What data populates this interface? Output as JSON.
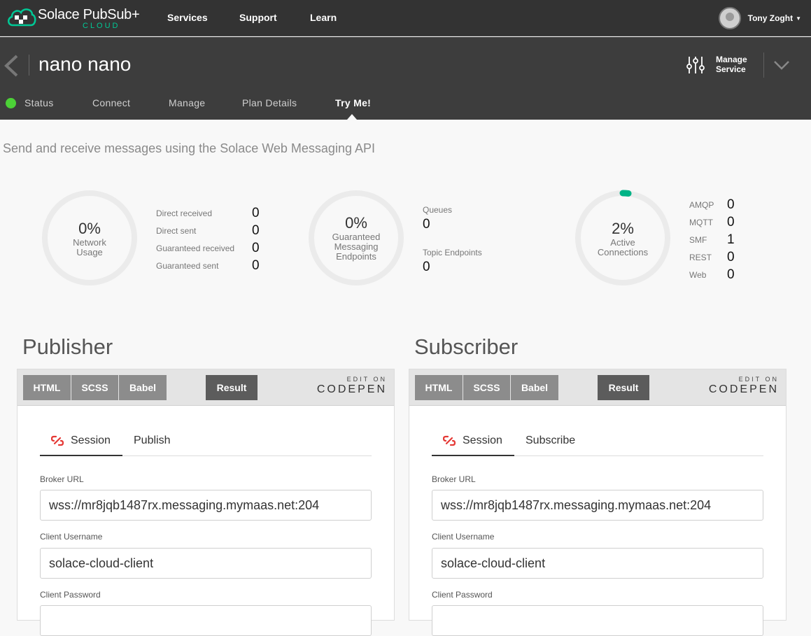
{
  "brand": {
    "name": "Solace PubSub+",
    "sub": "CLOUD",
    "accent": "#00c895"
  },
  "nav": {
    "links": [
      "Services",
      "Support",
      "Learn"
    ],
    "user_name": "Tony Zoght"
  },
  "service": {
    "title": "nano nano",
    "manage_label_1": "Manage",
    "manage_label_2": "Service",
    "tabs": [
      "Status",
      "Connect",
      "Manage",
      "Plan Details",
      "Try Me!"
    ],
    "active_tab": "Try Me!",
    "status_color": "#4cd137"
  },
  "subtitle": "Send and receive messages using the Solace Web Messaging API",
  "stats": {
    "network": {
      "pct": "0%",
      "label_1": "Network",
      "label_2": "Usage",
      "rows": [
        {
          "label": "Direct received",
          "value": "0"
        },
        {
          "label": "Direct sent",
          "value": "0"
        },
        {
          "label": "Guaranteed received",
          "value": "0"
        },
        {
          "label": "Guaranteed sent",
          "value": "0"
        }
      ]
    },
    "endpoints": {
      "pct": "0%",
      "label_1": "Guaranteed",
      "label_2": "Messaging",
      "label_3": "Endpoints",
      "rows": [
        {
          "label": "Queues",
          "value": "0"
        },
        {
          "label": "Topic Endpoints",
          "value": "0"
        }
      ]
    },
    "connections": {
      "pct": "2%",
      "fill": 0.02,
      "label_1": "Active",
      "label_2": "Connections",
      "rows": [
        {
          "label": "AMQP",
          "value": "0"
        },
        {
          "label": "MQTT",
          "value": "0"
        },
        {
          "label": "SMF",
          "value": "1"
        },
        {
          "label": "REST",
          "value": "0"
        },
        {
          "label": "Web",
          "value": "0"
        }
      ]
    }
  },
  "codepen": {
    "buttons": [
      "HTML",
      "SCSS",
      "Babel"
    ],
    "result": "Result",
    "edit_on": "EDIT ON",
    "brand": "CODEPEN"
  },
  "publisher": {
    "title": "Publisher",
    "tabs": [
      "Session",
      "Publish"
    ],
    "broker_label": "Broker URL",
    "broker_value": "wss://mr8jqb1487rx.messaging.mymaas.net:204",
    "username_label": "Client Username",
    "username_value": "solace-cloud-client",
    "password_label": "Client Password"
  },
  "subscriber": {
    "title": "Subscriber",
    "tabs": [
      "Session",
      "Subscribe"
    ],
    "broker_label": "Broker URL",
    "broker_value": "wss://mr8jqb1487rx.messaging.mymaas.net:204",
    "username_label": "Client Username",
    "username_value": "solace-cloud-client",
    "password_label": "Client Password"
  }
}
